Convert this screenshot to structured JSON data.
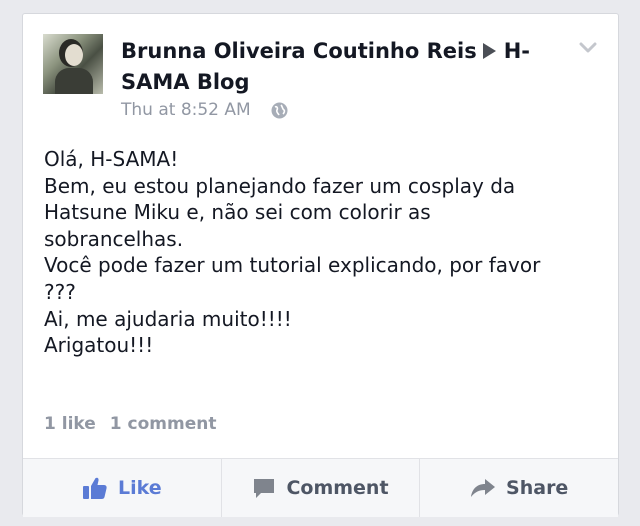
{
  "post": {
    "author_line1": "Brunna Oliveira Coutinho Reis",
    "target_fragment": "H-",
    "author_line2": "SAMA Blog",
    "timestamp": "Thu at 8:52 AM",
    "privacy_icon": "globe-icon",
    "menu_icon": "chevron-down-icon",
    "message_lines": [
      "Olá, H-SAMA!",
      "Bem, eu estou planejando fazer um cosplay da",
      "Hatsune Miku e, não sei com colorir as",
      "sobrancelhas.",
      "Você pode fazer um tutorial explicando, por favor",
      "???",
      "Ai, me ajudaria muito!!!!",
      "Arigatou!!!"
    ]
  },
  "counts": {
    "likes": "1 like",
    "comments": "1 comment"
  },
  "actions": {
    "like": "Like",
    "comment": "Comment",
    "share": "Share"
  },
  "colors": {
    "like_accent": "#5b7bd5",
    "muted_text": "#9197a3",
    "body_text": "#141823"
  }
}
